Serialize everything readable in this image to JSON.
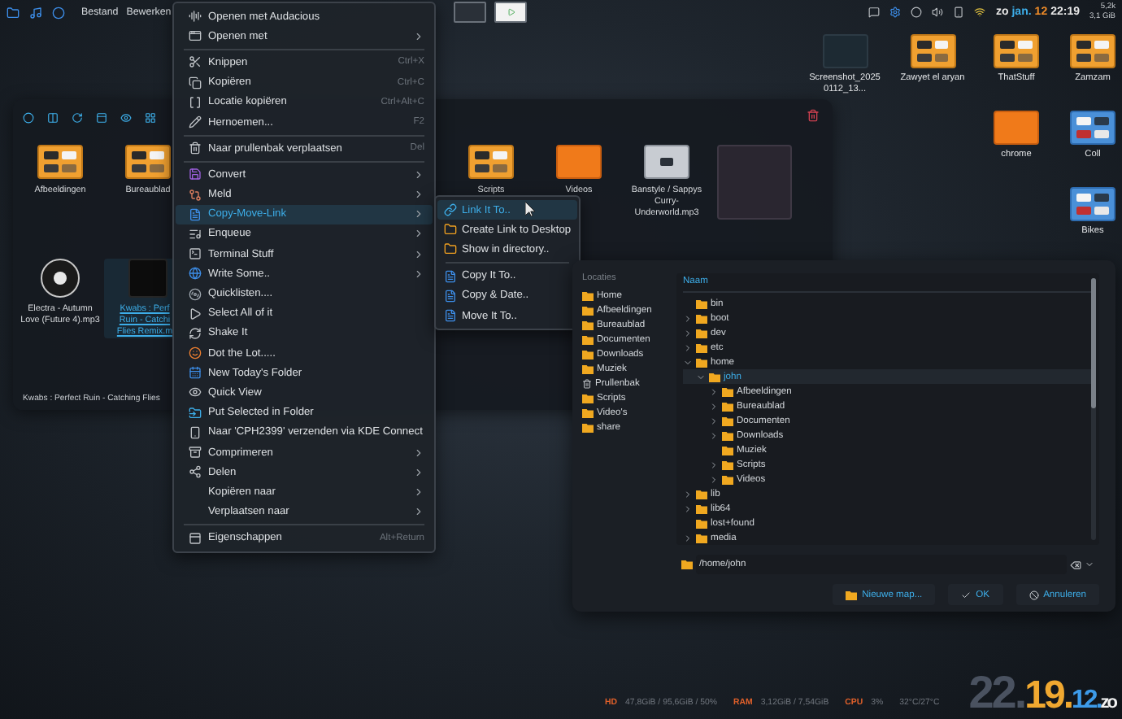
{
  "top_panel": {
    "menu": [
      {
        "label": "Bestand"
      },
      {
        "label": "Bewerken"
      }
    ],
    "clock": [
      {
        "text": "zo",
        "color": "#e6e6e6"
      },
      {
        "text": "jan.",
        "color": "#3daee9"
      },
      {
        "text": "12",
        "color": "#f08c28"
      },
      {
        "text": "22:19",
        "color": "#e6e6e6"
      }
    ],
    "net_rate": "5,2k",
    "memory": "3,1 GiB"
  },
  "desktop_icons": [
    {
      "label": "Screenshot_20250112_13...",
      "kind": "screenshot"
    },
    {
      "label": "Zawyet el aryan",
      "kind": "preview"
    },
    {
      "label": "ThatStuff",
      "kind": "preview"
    },
    {
      "label": "Zamzam",
      "kind": "preview"
    },
    {
      "label": "chrome",
      "kind": "folder"
    },
    {
      "label": "Coll",
      "kind": "bluepreview"
    },
    {
      "label": "Bikes",
      "kind": "bluepreview"
    }
  ],
  "file_manager": {
    "items": [
      {
        "label": "Afbeeldingen",
        "kind": "preview",
        "selected": false
      },
      {
        "label": "Bureaublad",
        "kind": "preview",
        "selected": false
      },
      {
        "label": "Scripts",
        "kind": "preview",
        "selected": false
      },
      {
        "label": "Videos",
        "kind": "folder",
        "selected": false
      },
      {
        "label": "Banstyle / Sappys Curry- Underworld.mp3",
        "kind": "image",
        "selected": false
      },
      {
        "kind": "album",
        "selected": false
      },
      {
        "label": "Electra - Autumn Love (Future 4).mp3",
        "kind": "disc",
        "selected": false
      },
      {
        "label": "Kwabs : Perf Ruin - Catchi Flies Remix.m",
        "kind": "cover",
        "selected": true
      }
    ],
    "status": "Kwabs : Perfect Ruin - Catching Flies"
  },
  "context_menu": {
    "items": [
      {
        "kind": "item",
        "label": "Openen met Audacious",
        "has_submenu": false,
        "selected": false
      },
      {
        "kind": "item",
        "label": "Openen met",
        "has_submenu": true,
        "selected": false
      },
      {
        "kind": "separator"
      },
      {
        "kind": "item",
        "label": "Knippen",
        "shortcut": "Ctrl+X",
        "has_submenu": false,
        "selected": false
      },
      {
        "kind": "item",
        "label": "Kopiëren",
        "shortcut": "Ctrl+C",
        "has_submenu": false,
        "selected": false
      },
      {
        "kind": "item",
        "label": "Locatie kopiëren",
        "shortcut": "Ctrl+Alt+C",
        "has_submenu": false,
        "selected": false
      },
      {
        "kind": "item",
        "label": "Hernoemen...",
        "shortcut": "F2",
        "has_submenu": false,
        "selected": false
      },
      {
        "kind": "separator"
      },
      {
        "kind": "item",
        "label": "Naar prullenbak verplaatsen",
        "shortcut": "Del",
        "has_submenu": false,
        "selected": false
      },
      {
        "kind": "separator"
      },
      {
        "kind": "item",
        "label": "Convert",
        "has_submenu": true,
        "selected": false
      },
      {
        "kind": "item",
        "label": "Meld",
        "has_submenu": true,
        "selected": false
      },
      {
        "kind": "item",
        "label": "Copy-Move-Link",
        "has_submenu": true,
        "selected": true
      },
      {
        "kind": "item",
        "label": "Enqueue",
        "has_submenu": true,
        "selected": false
      },
      {
        "kind": "item",
        "label": "Terminal Stuff",
        "has_submenu": true,
        "selected": false
      },
      {
        "kind": "item",
        "label": "Write Some..",
        "has_submenu": true,
        "selected": false
      },
      {
        "kind": "item",
        "label": "Quicklisten....",
        "has_submenu": false,
        "selected": false
      },
      {
        "kind": "item",
        "label": "Select All of it",
        "has_submenu": false,
        "selected": false
      },
      {
        "kind": "item",
        "label": "Shake It",
        "has_submenu": false,
        "selected": false
      },
      {
        "kind": "item",
        "label": "Dot the Lot.....",
        "has_submenu": false,
        "selected": false
      },
      {
        "kind": "item",
        "label": "New Today's Folder",
        "has_submenu": false,
        "selected": false
      },
      {
        "kind": "item",
        "label": "Quick View",
        "has_submenu": false,
        "selected": false
      },
      {
        "kind": "item",
        "label": "Put Selected in Folder",
        "has_submenu": false,
        "selected": false
      },
      {
        "kind": "item",
        "label": "Naar 'CPH2399' verzenden via KDE Connect",
        "has_submenu": false,
        "selected": false
      },
      {
        "kind": "item",
        "label": "Comprimeren",
        "has_submenu": true,
        "selected": false
      },
      {
        "kind": "item",
        "label": "Delen",
        "has_submenu": true,
        "selected": false
      },
      {
        "kind": "item",
        "label": "Kopiëren naar",
        "has_submenu": true,
        "selected": false
      },
      {
        "kind": "item",
        "label": "Verplaatsen naar",
        "has_submenu": true,
        "selected": false
      },
      {
        "kind": "separator"
      },
      {
        "kind": "item",
        "label": "Eigenschappen",
        "shortcut": "Alt+Return",
        "has_submenu": false,
        "selected": false
      }
    ]
  },
  "submenu": {
    "items": [
      {
        "kind": "item",
        "label": "Link It To..",
        "selected": true
      },
      {
        "kind": "item",
        "label": "Create Link to Desktop",
        "selected": false
      },
      {
        "kind": "item",
        "label": "Show in directory..",
        "selected": false
      },
      {
        "kind": "separator"
      },
      {
        "kind": "item",
        "label": "Copy It To..",
        "selected": false
      },
      {
        "kind": "item",
        "label": "Copy & Date..",
        "selected": false
      },
      {
        "kind": "item",
        "label": "Move It To..",
        "selected": false
      }
    ]
  },
  "folder_dialog": {
    "places_title": "Locaties",
    "places": [
      {
        "label": "Home",
        "kind": "folder"
      },
      {
        "label": "Afbeeldingen",
        "kind": "folder"
      },
      {
        "label": "Bureaublad",
        "kind": "folder"
      },
      {
        "label": "Documenten",
        "kind": "folder"
      },
      {
        "label": "Downloads",
        "kind": "folder"
      },
      {
        "label": "Muziek",
        "kind": "folder"
      },
      {
        "label": "Prullenbak",
        "kind": "trash"
      },
      {
        "label": "Scripts",
        "kind": "folder"
      },
      {
        "label": "Video's",
        "kind": "folder"
      },
      {
        "label": "share",
        "kind": "folder"
      }
    ],
    "column": "Naam",
    "tree": [
      {
        "label": "bin",
        "selected": false
      },
      {
        "label": "boot",
        "expanded": false,
        "selected": false
      },
      {
        "label": "dev",
        "expanded": false,
        "selected": false
      },
      {
        "label": "etc",
        "expanded": false,
        "selected": false
      },
      {
        "label": "home",
        "expanded": true,
        "selected": false,
        "children": [
          {
            "label": "john",
            "expanded": true,
            "selected": true,
            "children": [
              {
                "label": "Afbeeldingen",
                "expanded": false,
                "selected": false
              },
              {
                "label": "Bureaublad",
                "expanded": false,
                "selected": false
              },
              {
                "label": "Documenten",
                "expanded": false,
                "selected": false
              },
              {
                "label": "Downloads",
                "expanded": false,
                "selected": false
              },
              {
                "label": "Muziek",
                "selected": false
              },
              {
                "label": "Scripts",
                "expanded": false,
                "selected": false
              },
              {
                "label": "Videos",
                "expanded": false,
                "selected": false
              }
            ]
          }
        ]
      },
      {
        "label": "lib",
        "expanded": false,
        "selected": false
      },
      {
        "label": "lib64",
        "expanded": false,
        "selected": false
      },
      {
        "label": "lost+found",
        "selected": false
      },
      {
        "label": "media",
        "expanded": false,
        "selected": false
      }
    ],
    "path": "/home/john",
    "buttons": [
      {
        "label": "Nieuwe map...",
        "kind": "new"
      },
      {
        "label": "OK",
        "kind": "ok"
      },
      {
        "label": "Annuleren",
        "kind": "cancel"
      }
    ]
  },
  "system_monitor": {
    "stats": [
      {
        "label": "HD",
        "value": "47,8GiB / 95,6GiB / 50%"
      },
      {
        "label": "RAM",
        "value": "3,12GiB / 7,54GiB"
      },
      {
        "label": "CPU",
        "value": "3%"
      }
    ],
    "temperature": "32°C/27°C"
  },
  "desktop_clock": [
    {
      "text": "22.",
      "color": "#4a5260"
    },
    {
      "text": "19.",
      "color": "#f0a830"
    },
    {
      "text": "12.",
      "color": "#3d9be9"
    },
    {
      "text": "zo",
      "color": "#f2f2f2"
    }
  ]
}
